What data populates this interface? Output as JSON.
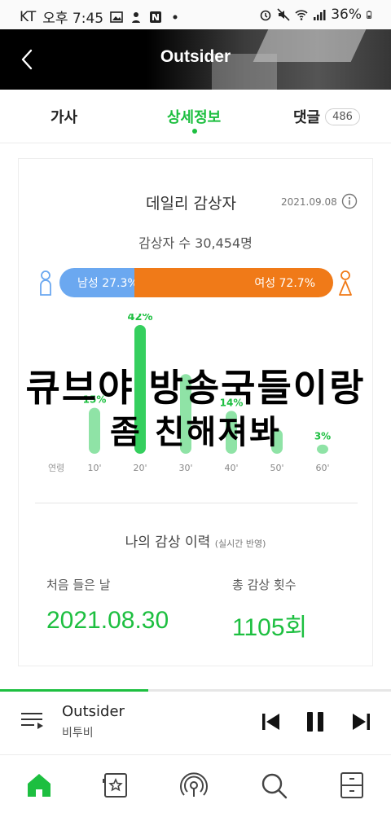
{
  "status_bar": {
    "carrier": "KT",
    "time": "오후 7:45",
    "battery": "36%"
  },
  "header": {
    "title": "Outsider"
  },
  "tabs": {
    "lyrics": "가사",
    "info": "상세정보",
    "comments": "댓글",
    "comment_count": "486",
    "active": "info"
  },
  "daily_listeners": {
    "title": "데일리 감상자",
    "date": "2021.09.08",
    "count_text": "감상자 수 30,454명",
    "male_label": "남성 27.3%",
    "female_label": "여성 72.7%",
    "male_ratio": 27.3,
    "female_ratio": 72.7
  },
  "chart_data": {
    "type": "bar",
    "x_axis_label": "연령",
    "categories": [
      "10'",
      "20'",
      "30'",
      "40'",
      "50'",
      "60'"
    ],
    "values": [
      15,
      42,
      26,
      14,
      8,
      3
    ],
    "value_labels": [
      "15%",
      "42%",
      "",
      "14%",
      "",
      "3%"
    ],
    "highlight_index": 1,
    "ylim": [
      0,
      42
    ],
    "colors": {
      "bar": "#8fe3a6",
      "highlight": "#35cf5e",
      "label": "#1dbf40"
    }
  },
  "history": {
    "title": "나의 감상 이력",
    "subtitle": "(실시간 반영)",
    "first_listen_label": "처음 들은 날",
    "first_listen_value": "2021.08.30",
    "total_label": "총 감상 횟수",
    "total_value": "1105회"
  },
  "overlay_caption": {
    "line1": "큐브야 방송국들이랑",
    "line2": "좀 친해져봐"
  },
  "player": {
    "title": "Outsider",
    "artist": "비투비",
    "progress": 0.38
  },
  "nav": {
    "items": [
      "home-icon",
      "my-music-icon",
      "podcast-icon",
      "search-icon",
      "drawer-icon"
    ],
    "active": "home-icon"
  },
  "colors": {
    "accent": "#1dbf40",
    "male": "#6ba8f0",
    "female": "#f07a18"
  }
}
